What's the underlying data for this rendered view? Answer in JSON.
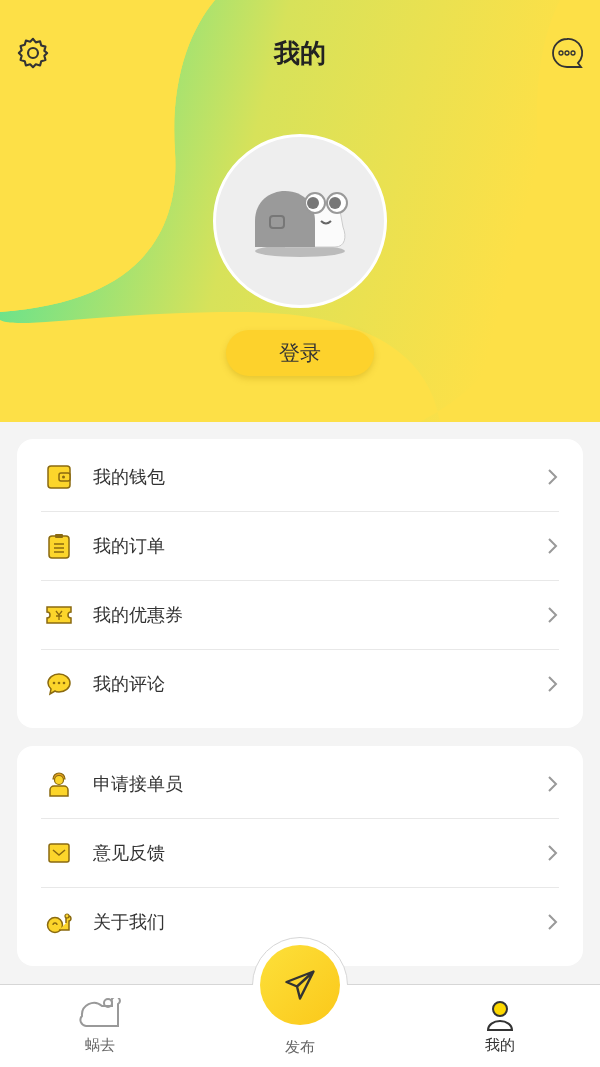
{
  "header": {
    "title": "我的",
    "login_button": "登录"
  },
  "menu_groups": [
    {
      "items": [
        {
          "kind": "wallet",
          "label": "我的钱包"
        },
        {
          "kind": "orders",
          "label": "我的订单"
        },
        {
          "kind": "coupon",
          "label": "我的优惠券"
        },
        {
          "kind": "comment",
          "label": "我的评论"
        }
      ]
    },
    {
      "items": [
        {
          "kind": "courier",
          "label": "申请接单员"
        },
        {
          "kind": "feedback",
          "label": "意见反馈"
        },
        {
          "kind": "about",
          "label": "关于我们"
        }
      ]
    }
  ],
  "tab_bar": [
    {
      "kind": "snail",
      "label": "蜗去",
      "selected": false
    },
    {
      "kind": "publish",
      "label": "发布",
      "selected": false
    },
    {
      "kind": "profile",
      "label": "我的",
      "selected": true
    }
  ]
}
